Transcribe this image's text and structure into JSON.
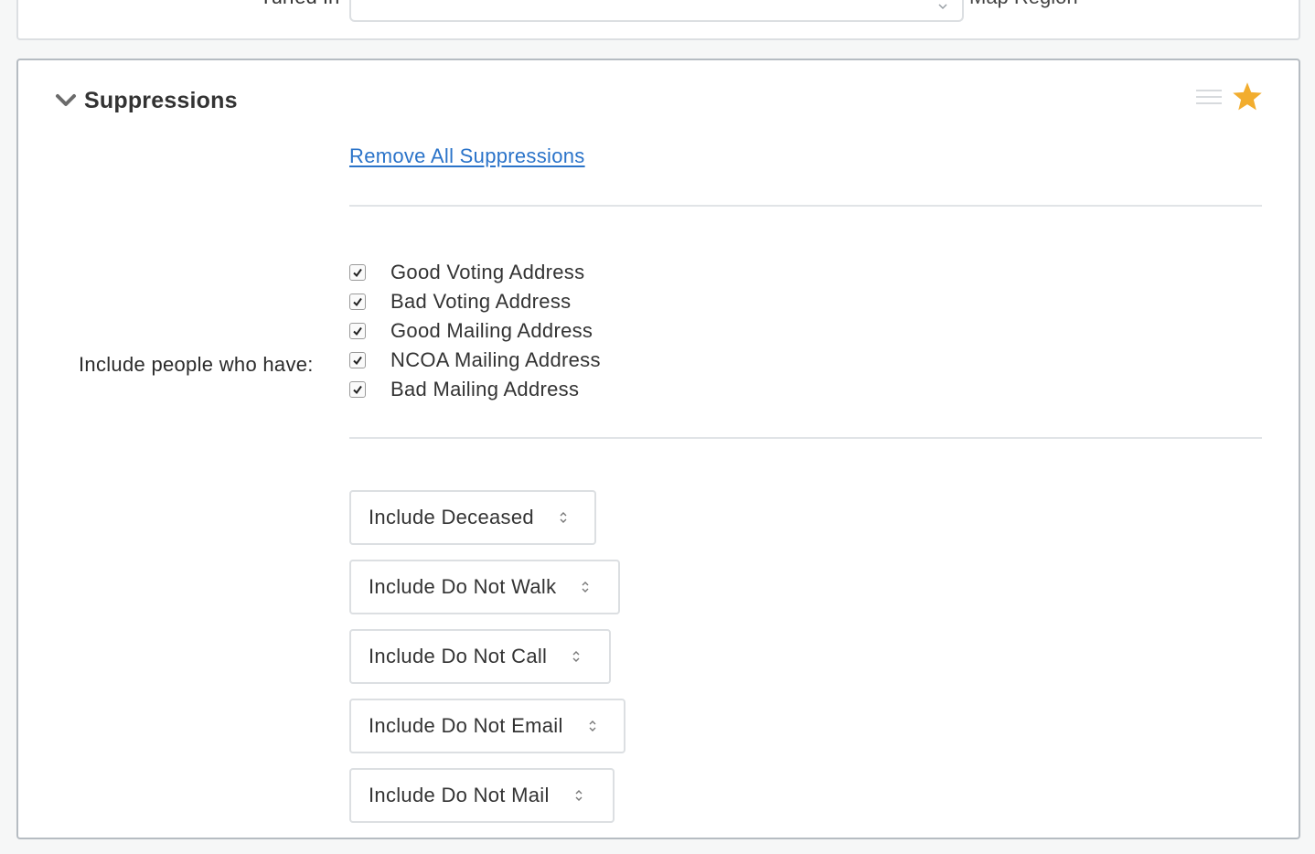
{
  "previous_panel": {
    "field_label": "Turfed In",
    "select_value": "",
    "after_text": "Map Region"
  },
  "suppressions": {
    "title": "Suppressions",
    "remove_all_link": "Remove All Suppressions",
    "include_label": "Include people who have:",
    "checkboxes": [
      {
        "label": "Good Voting Address",
        "checked": true
      },
      {
        "label": "Bad Voting Address",
        "checked": true
      },
      {
        "label": "Good Mailing Address",
        "checked": true
      },
      {
        "label": "NCOA Mailing Address",
        "checked": true
      },
      {
        "label": "Bad Mailing Address",
        "checked": true
      }
    ],
    "selects": [
      {
        "value": "Include Deceased"
      },
      {
        "value": "Include Do Not Walk"
      },
      {
        "value": "Include Do Not Call"
      },
      {
        "value": "Include Do Not Email"
      },
      {
        "value": "Include Do Not Mail"
      }
    ],
    "star_color": "#f2ad2e"
  },
  "icons": {
    "collapse": "chevron-down-icon",
    "drag": "drag-handle-icon",
    "favorite": "star-icon",
    "checkbox": "checkmark-icon",
    "select_arrows": "updown-arrows-icon"
  }
}
